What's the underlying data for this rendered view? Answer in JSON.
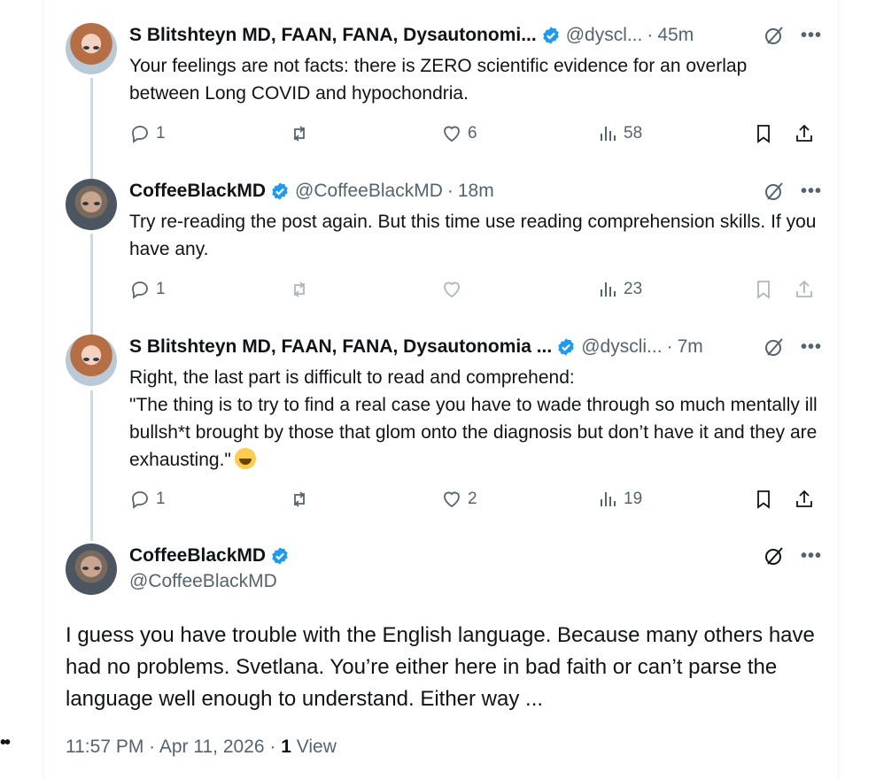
{
  "colors": {
    "verified": "#1d9bf0",
    "text": "#0f1419",
    "muted": "#536471",
    "line": "#cfd9de"
  },
  "left_dots": "••",
  "replies": [
    {
      "author": "S Blitshteyn MD, FAAN, FANA, Dysautonomi...",
      "handle": "@dyscl...",
      "time": "45m",
      "text": "Your feelings are not facts: there is ZERO scientific evidence for an overlap between Long COVID and hypochondria.",
      "stats": {
        "replies": "1",
        "reposts": "",
        "likes": "6",
        "views": "58"
      }
    },
    {
      "author": "CoffeeBlackMD",
      "handle": "@CoffeeBlackMD",
      "time": "18m",
      "text": "Try re-reading the post again. But this time use reading comprehension skills. If you have any.",
      "stats": {
        "replies": "1",
        "reposts": "",
        "likes": "",
        "views": "23"
      }
    },
    {
      "author": "S Blitshteyn MD, FAAN, FANA, Dysautonomia ...",
      "handle": "@dyscli...",
      "time": "7m",
      "text_lines": [
        "Right, the last part is difficult to read and comprehend:",
        "\"The thing is to try to find a real case you have to wade through so much mentally ill bullsh*t brought by those that glom onto the diagnosis but don’t have it and they are exhausting.\""
      ],
      "stats": {
        "replies": "1",
        "reposts": "",
        "likes": "2",
        "views": "19"
      }
    }
  ],
  "main_post": {
    "author": "CoffeeBlackMD",
    "handle": "@CoffeeBlackMD",
    "text": "I guess you have trouble with the English language. Because many others have had no problems. Svetlana. You’re either here in bad faith or can’t parse the language well enough to understand. Either way ...",
    "timestamp": "11:57 PM · Apr 11, 2026 · ",
    "view_count": "1",
    "view_label": "View"
  },
  "icons": [
    "verified-badge-icon",
    "grok-icon",
    "more-icon",
    "reply-icon",
    "repost-icon",
    "like-icon",
    "views-icon",
    "bookmark-icon",
    "share-icon",
    "laughing-emoji"
  ]
}
